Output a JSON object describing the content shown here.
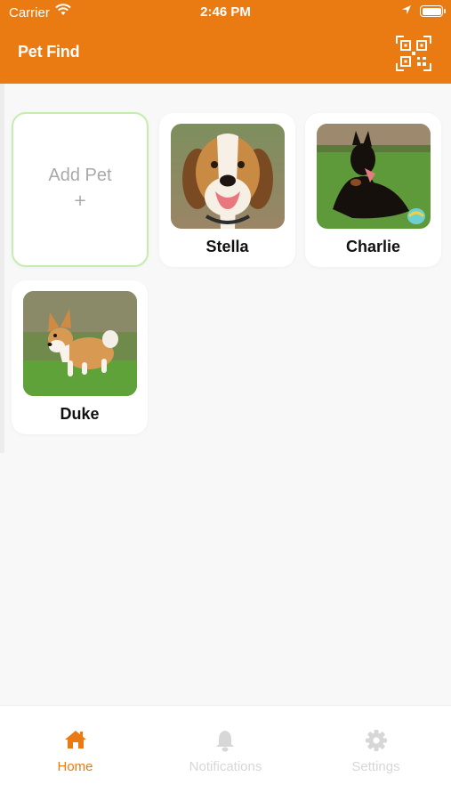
{
  "status_bar": {
    "carrier": "Carrier",
    "time": "2:46 PM"
  },
  "header": {
    "title": "Pet Find",
    "qr_icon": "qr-code-icon"
  },
  "add_pet": {
    "label": "Add Pet",
    "plus": "+"
  },
  "pets": [
    {
      "name": "Stella"
    },
    {
      "name": "Charlie"
    },
    {
      "name": "Duke"
    }
  ],
  "tabs": [
    {
      "label": "Home",
      "icon": "home-icon",
      "active": true
    },
    {
      "label": "Notifications",
      "icon": "bell-icon",
      "active": false
    },
    {
      "label": "Settings",
      "icon": "gear-icon",
      "active": false
    }
  ],
  "colors": {
    "brand": "#ea7a12",
    "active_tab": "#ea7a12",
    "inactive_tab": "#d7d7d7",
    "add_border": "#c5edb0"
  }
}
